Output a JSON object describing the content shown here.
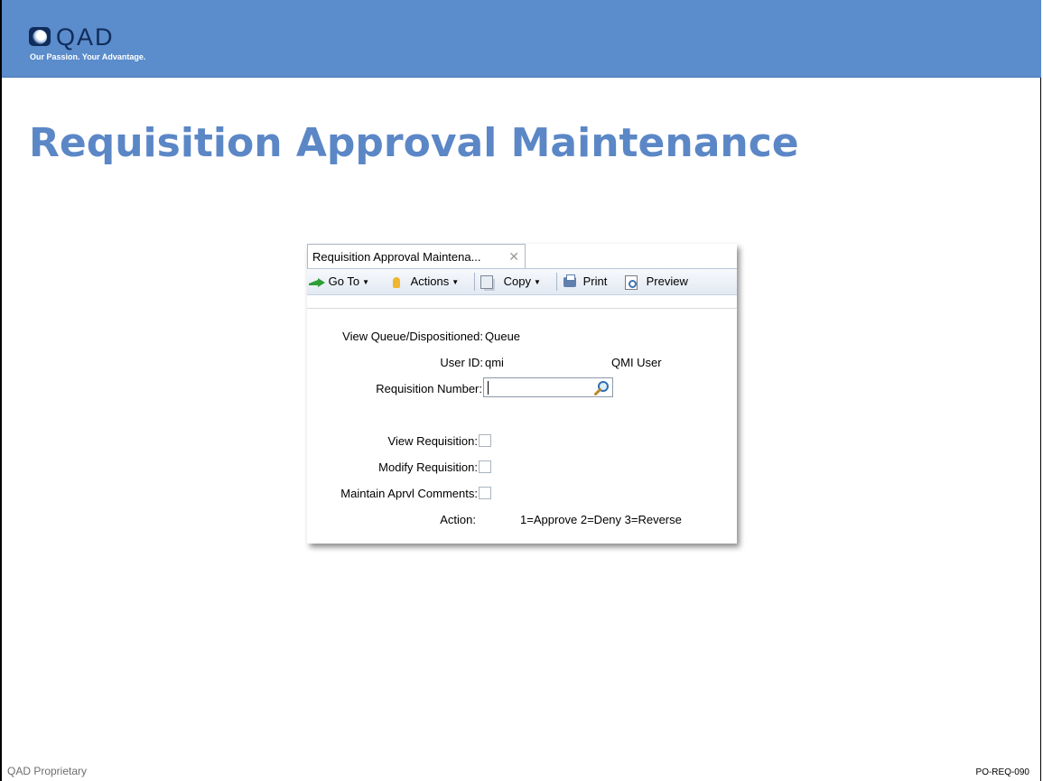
{
  "brand": {
    "logo_text": "QAD",
    "tagline": "Our Passion. Your Advantage."
  },
  "slide": {
    "title": "Requisition Approval Maintenance",
    "footer_left": "QAD Proprietary",
    "footer_right": "PO-REQ-090"
  },
  "app": {
    "tab": {
      "label": "Requisition Approval Maintena...",
      "close": "✕"
    },
    "toolbar": {
      "goto_label": "Go To",
      "actions_label": "Actions",
      "copy_label": "Copy",
      "print_label": "Print",
      "preview_label": "Preview",
      "dropdown_caret": "▼"
    },
    "form": {
      "view_queue_label": "View Queue/Dispositioned:",
      "view_queue_value": "Queue",
      "user_id_label": "User ID:",
      "user_id_value": "qmi",
      "user_name_value": "QMI User",
      "req_number_label": "Requisition Number:",
      "req_number_value": "",
      "view_req_label": "View Requisition:",
      "view_req_checked": false,
      "modify_req_label": "Modify Requisition:",
      "modify_req_checked": false,
      "maintain_comments_label": "Maintain Aprvl Comments:",
      "maintain_comments_checked": false,
      "action_label": "Action:",
      "action_value": "1=Approve 2=Deny 3=Reverse"
    }
  },
  "colors": {
    "header_band": "#5b8ccb",
    "title": "#5b87c6",
    "logo_dark": "#0f2c5a"
  }
}
